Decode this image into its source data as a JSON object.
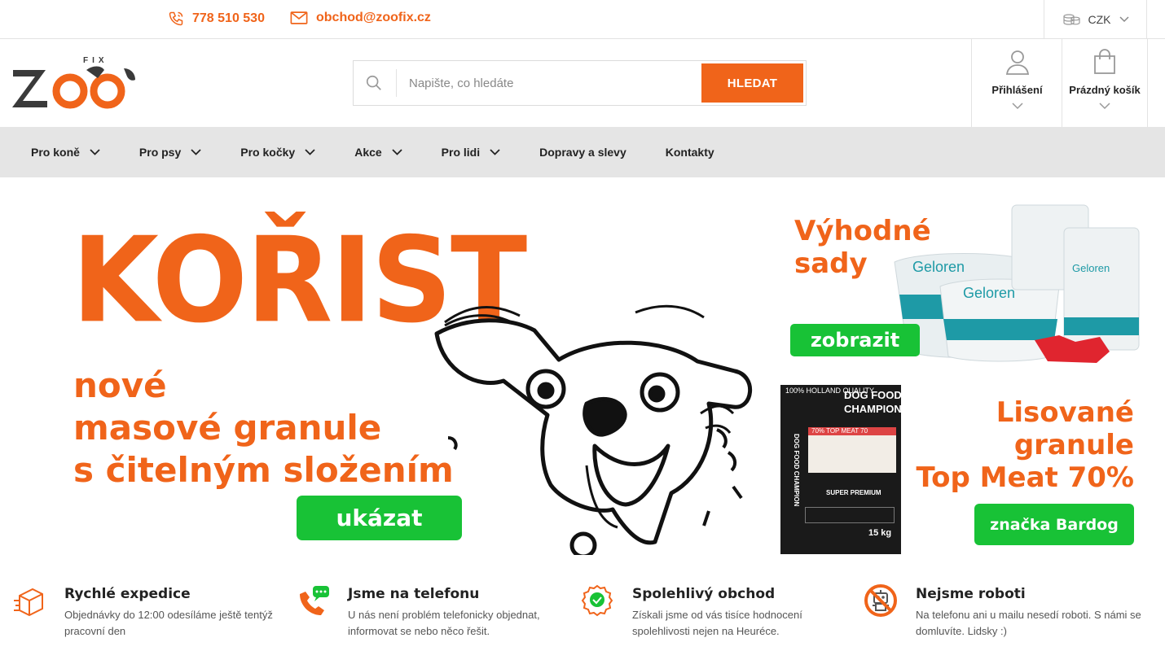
{
  "topbar": {
    "phone": "778 510 530",
    "email": "obchod@zoofix.cz",
    "currency": "CZK"
  },
  "header": {
    "logo_main": "Zoo",
    "logo_small": "FIX",
    "search": {
      "placeholder": "Napište, co hledáte",
      "button_label": "HLEDAT"
    },
    "login_label": "Přihlášení",
    "cart_label": "Prázdný košík"
  },
  "nav": {
    "items": [
      {
        "label": "Pro koně",
        "has_dropdown": true
      },
      {
        "label": "Pro psy",
        "has_dropdown": true
      },
      {
        "label": "Pro kočky",
        "has_dropdown": true
      },
      {
        "label": "Akce",
        "has_dropdown": true
      },
      {
        "label": "Pro lidi",
        "has_dropdown": true
      },
      {
        "label": "Dopravy a slevy",
        "has_dropdown": false
      },
      {
        "label": "Kontakty",
        "has_dropdown": false
      }
    ]
  },
  "hero": {
    "title": "KOŘIST",
    "line1": "nové",
    "line2": "masové granule",
    "line3": "s čitelným složením",
    "button": "ukázat"
  },
  "promo1": {
    "line1": "Výhodné",
    "line2": "sady",
    "button": "zobrazit",
    "brand": "Geloren"
  },
  "promo2": {
    "line1": "Lisované",
    "line2": "granule",
    "line3": "Top Meat 70%",
    "button": "značka Bardog",
    "bag": {
      "top": "100% HOLLAND QUALITY",
      "title1": "DOG FOOD",
      "title2": "CHAMPION",
      "stripe": "70% TOP MEAT 70",
      "grade": "SUPER PREMIUM",
      "weight": "15 kg",
      "side": "DOG FOOD CHAMPION"
    }
  },
  "features": [
    {
      "title": "Rychlé expedice",
      "desc": "Objednávky do 12:00 odesíláme ještě tentýž pracovní den",
      "icon": "package-icon"
    },
    {
      "title": "Jsme na telefonu",
      "desc": "U nás není problém telefonicky objednat, informovat se nebo něco řešit.",
      "icon": "phone-chat-icon"
    },
    {
      "title": "Spolehlivý obchod",
      "desc": "Získali jsme od vás tisíce hodnocení spolehlivosti nejen na Heuréce.",
      "icon": "award-badge-icon"
    },
    {
      "title": "Nejsme roboti",
      "desc": "Na telefonu ani u mailu nesedí roboti. S námi se domluvíte. Lidsky :)",
      "icon": "no-robot-icon"
    }
  ],
  "colors": {
    "accent": "#f0641a",
    "green": "#18c236",
    "nav_bg": "#e5e5e5"
  }
}
